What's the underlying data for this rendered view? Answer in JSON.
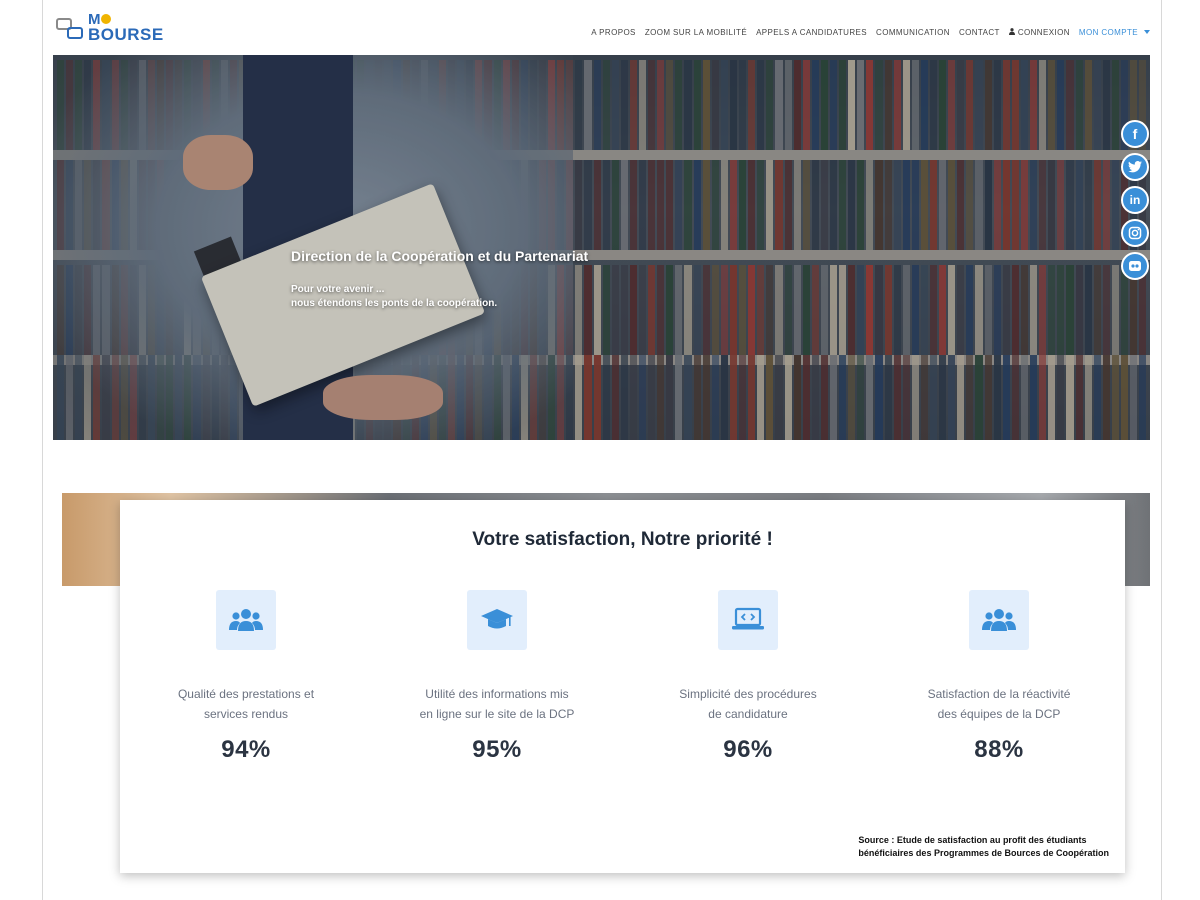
{
  "brand": {
    "logo_m": "M",
    "logo_text": "BOURSE"
  },
  "nav": {
    "items": [
      "A PROPOS",
      "ZOOM SUR LA MOBILITÉ",
      "APPELS A CANDIDATURES",
      "COMMUNICATION",
      "CONTACT"
    ],
    "login": "CONNEXION",
    "account": "MON COMPTE"
  },
  "hero": {
    "title": "Direction de la Coopération et du Partenariat",
    "subtitle_line1": "Pour votre avenir ...",
    "subtitle_line2": "nous étendons les ponts de la coopération."
  },
  "social": [
    "facebook-icon",
    "twitter-icon",
    "linkedin-icon",
    "instagram-icon",
    "flickr-icon"
  ],
  "satisfaction": {
    "title": "Votre satisfaction, Notre priorité !",
    "stats": [
      {
        "icon": "users-icon",
        "label_line1": "Qualité des prestations et",
        "label_line2": "services rendus",
        "value": "94%"
      },
      {
        "icon": "graduation-cap-icon",
        "label_line1": "Utilité des informations mis",
        "label_line2": "en ligne sur le site de la DCP",
        "value": "95%"
      },
      {
        "icon": "laptop-code-icon",
        "label_line1": "Simplicité des procédures",
        "label_line2": "de candidature",
        "value": "96%"
      },
      {
        "icon": "users-icon",
        "label_line1": "Satisfaction de la réactivité",
        "label_line2": "des équipes de la DCP",
        "value": "88%"
      }
    ],
    "source_line1": "Source : Etude de satisfaction au profit des étudiants",
    "source_line2": "bénéficiaires des Programmes de Bources de Coopération"
  },
  "colors": {
    "accent": "#3a8fd8",
    "brand": "#2b6ab8",
    "icon_bg": "#e2eefc"
  }
}
